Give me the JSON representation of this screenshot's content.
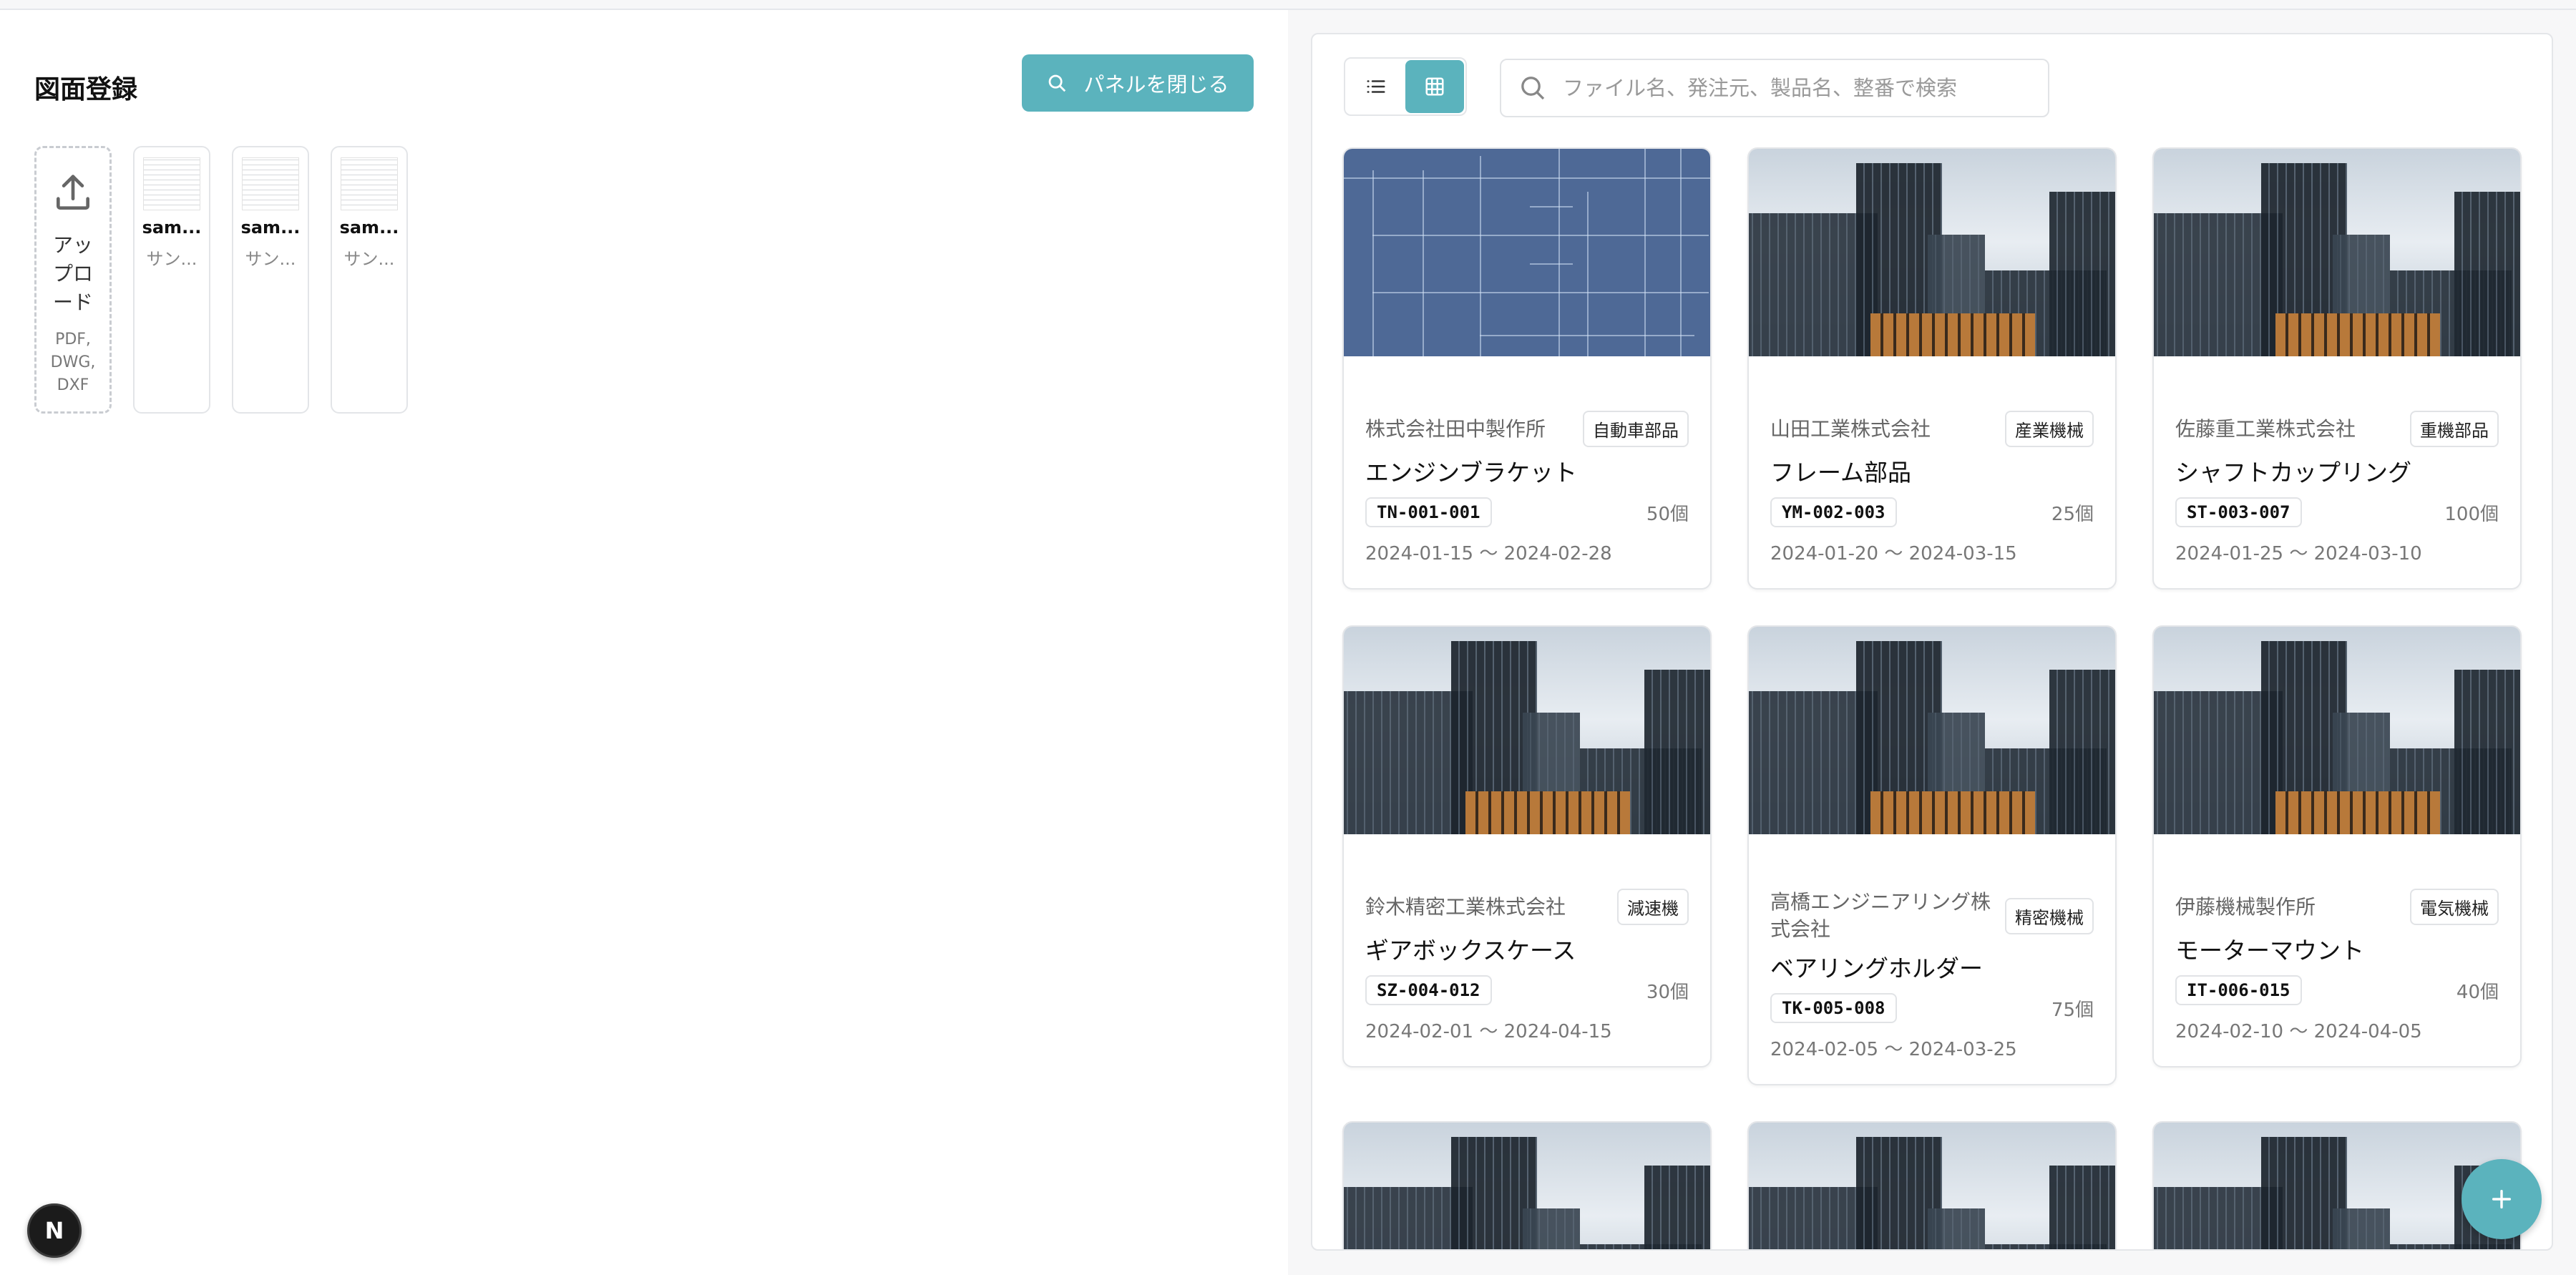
{
  "left_panel": {
    "title": "図面登録",
    "close_button": "パネルを閉じる",
    "upload": {
      "label": "アップロード",
      "formats": "PDF, DWG, DXF"
    },
    "files": [
      {
        "name": "sam...",
        "subtitle": "サン..."
      },
      {
        "name": "sam...",
        "subtitle": "サン..."
      },
      {
        "name": "sam...",
        "subtitle": "サン..."
      }
    ]
  },
  "right_panel": {
    "search_placeholder": "ファイル名、発注元、製品名、整番で検索",
    "view_modes": [
      "list-icon",
      "grid-icon"
    ],
    "active_view": "grid",
    "cards": [
      {
        "company": "株式会社田中製作所",
        "category": "自動車部品",
        "product": "エンジンブラケット",
        "code": "TN-001-001",
        "quantity": "50個",
        "dates": "2024-01-15 〜 2024-02-28",
        "image": "blueprint"
      },
      {
        "company": "山田工業株式会社",
        "category": "産業機械",
        "product": "フレーム部品",
        "code": "YM-002-003",
        "quantity": "25個",
        "dates": "2024-01-20 〜 2024-03-15",
        "image": "city"
      },
      {
        "company": "佐藤重工業株式会社",
        "category": "重機部品",
        "product": "シャフトカップリング",
        "code": "ST-003-007",
        "quantity": "100個",
        "dates": "2024-01-25 〜 2024-03-10",
        "image": "city"
      },
      {
        "company": "鈴木精密工業株式会社",
        "category": "減速機",
        "product": "ギアボックスケース",
        "code": "SZ-004-012",
        "quantity": "30個",
        "dates": "2024-02-01 〜 2024-04-15",
        "image": "city"
      },
      {
        "company": "高橋エンジニアリング株式会社",
        "category": "精密機械",
        "product": "ベアリングホルダー",
        "code": "TK-005-008",
        "quantity": "75個",
        "dates": "2024-02-05 〜 2024-03-25",
        "image": "city"
      },
      {
        "company": "伊藤機械製作所",
        "category": "電気機械",
        "product": "モーターマウント",
        "code": "IT-006-015",
        "quantity": "40個",
        "dates": "2024-02-10 〜 2024-04-05",
        "image": "city"
      },
      {
        "image": "city"
      },
      {
        "image": "city"
      },
      {
        "image": "city"
      }
    ]
  },
  "fab": {
    "icon": "plus-icon"
  },
  "next_badge": {
    "label": "N"
  },
  "colors": {
    "accent": "#5bb3bd",
    "border": "#e3e5e8"
  }
}
